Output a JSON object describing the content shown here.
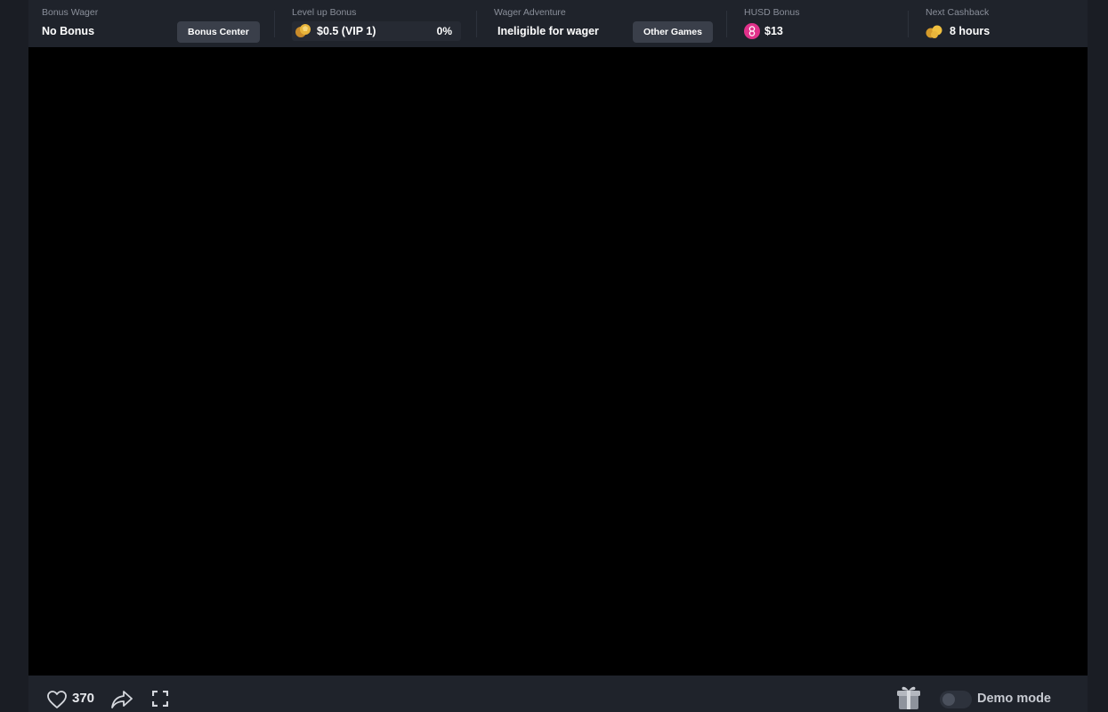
{
  "topbar": {
    "bonus_wager": {
      "label": "Bonus Wager",
      "value": "No Bonus",
      "button": "Bonus Center"
    },
    "level_up": {
      "label": "Level up Bonus",
      "value": "$0.5 (VIP 1)",
      "progress_text": "0%",
      "progress": 0
    },
    "wager_adventure": {
      "label": "Wager Adventure",
      "value": "Ineligible for wager",
      "button": "Other Games"
    },
    "husd_bonus": {
      "label": "HUSD Bonus",
      "value": "$13"
    },
    "next_cashback": {
      "label": "Next Cashback",
      "value": "8 hours"
    }
  },
  "bottombar": {
    "like_count": "370",
    "demo_mode_label": "Demo mode",
    "demo_mode_on": false
  },
  "icons": {
    "like": "heart-icon",
    "share": "share-icon",
    "fullscreen": "fullscreen-icon",
    "gift": "gift-icon",
    "vip": "vip-coin-icon",
    "husd": "husd-coin-icon",
    "cashback": "cashback-coin-icon"
  },
  "colors": {
    "background": "#1a1d24",
    "bar": "#1f232b",
    "game": "#000000",
    "button": "#3a3f4a",
    "husd_pink": "#e0318a",
    "gold": "#e8b53b"
  }
}
